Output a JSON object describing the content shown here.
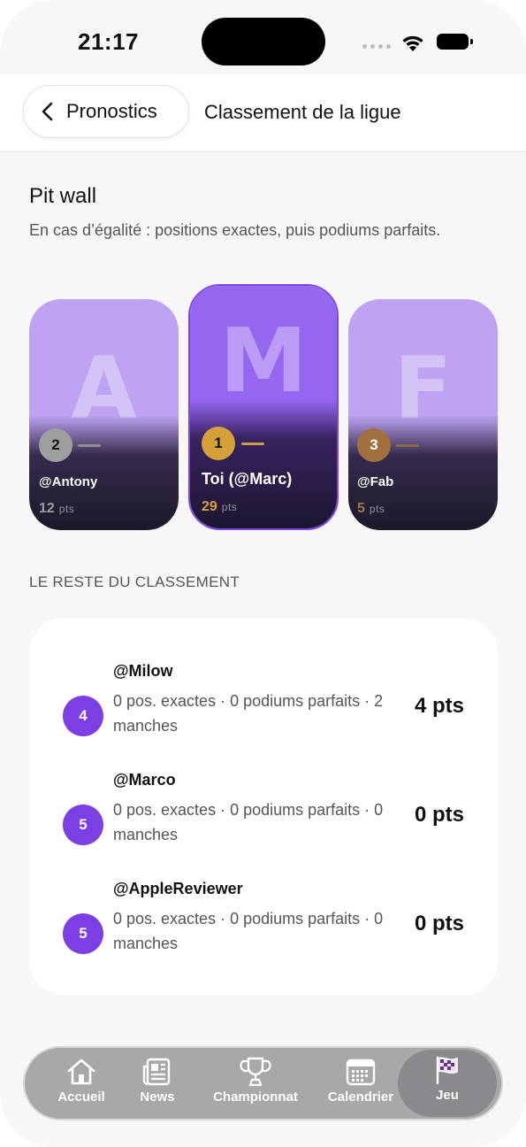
{
  "status": {
    "time": "21:17"
  },
  "nav": {
    "back_label": "Pronostics",
    "title": "Classement de la ligue"
  },
  "league": {
    "name": "Pit wall",
    "tiebreak": "En cas d’égalité : positions exactes, puis podiums parfaits."
  },
  "podium": [
    {
      "letter": "A",
      "rank": "2",
      "name": "@Antony",
      "points": "12",
      "unit": "pts"
    },
    {
      "letter": "M",
      "rank": "1",
      "name": "Toi (@Marc)",
      "points": "29",
      "unit": "pts"
    },
    {
      "letter": "F",
      "rank": "3",
      "name": "@Fab",
      "points": "5",
      "unit": "pts"
    }
  ],
  "rest": {
    "title": "LE RESTE DU CLASSEMENT",
    "rows": [
      {
        "rank": "4",
        "name": "@Milow",
        "stats": "0 pos. exactes · 0 podiums parfaits · 2 manches",
        "score": "4 pts"
      },
      {
        "rank": "5",
        "name": "@Marco",
        "stats": "0 pos. exactes · 0 podiums parfaits · 0 manches",
        "score": "0 pts"
      },
      {
        "rank": "5",
        "name": "@AppleReviewer",
        "stats": "0 pos. exactes · 0 podiums parfaits · 0 manches",
        "score": "0 pts"
      }
    ]
  },
  "tabs": [
    {
      "label": "Accueil",
      "icon": "house-icon"
    },
    {
      "label": "News",
      "icon": "newspaper-icon"
    },
    {
      "label": "Championnat",
      "icon": "trophy-icon"
    },
    {
      "label": "Calendrier",
      "icon": "calendar-icon"
    },
    {
      "label": "Jeu",
      "icon": "checkered-flag-icon",
      "active": true
    }
  ],
  "colors": {
    "accent": "#7b3fe4",
    "gold": "#d4a038",
    "silver": "#9e9e9e",
    "bronze": "#a0703e"
  }
}
